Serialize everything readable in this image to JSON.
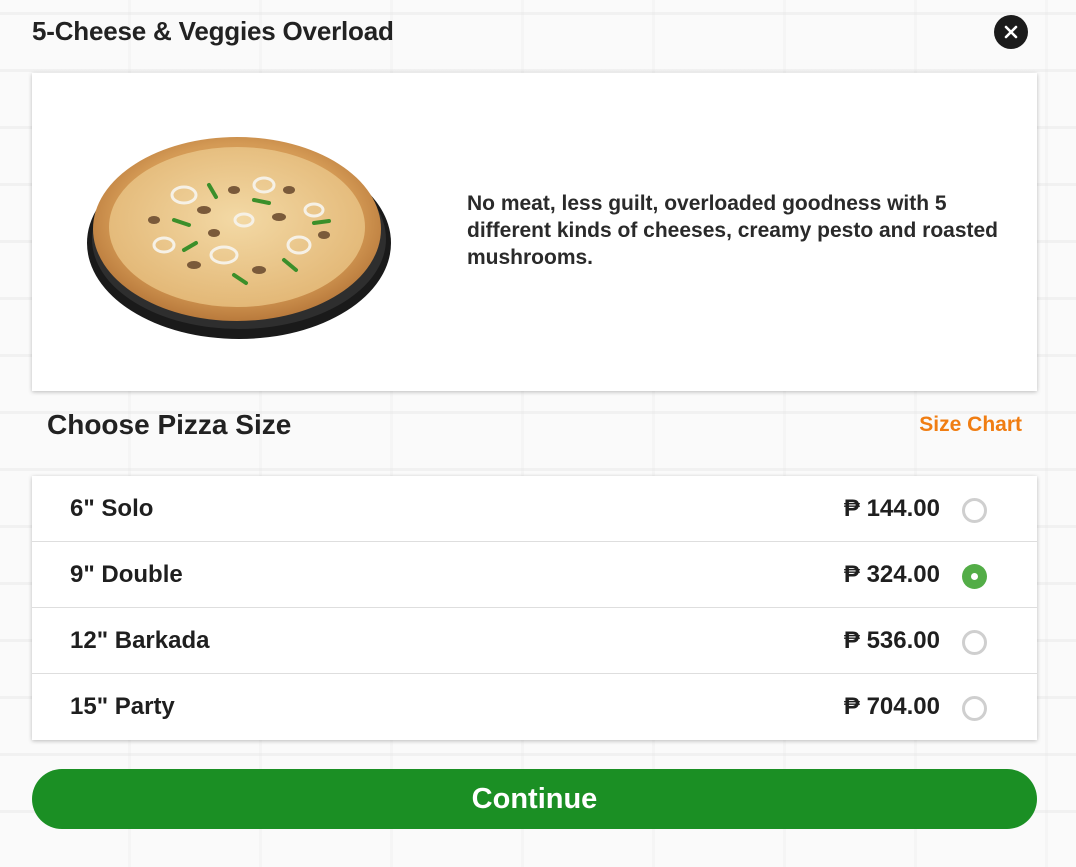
{
  "modal": {
    "title": "5-Cheese & Veggies Overload",
    "close_icon": "close-icon",
    "description": "No meat, less guilt, overloaded goodness with 5 different kinds of cheeses, creamy pesto and roasted mushrooms."
  },
  "sizes": {
    "title": "Choose Pizza Size",
    "size_chart_label": "Size Chart",
    "options": [
      {
        "label": "6\" Solo",
        "price": "₱ 144.00",
        "selected": false
      },
      {
        "label": "9\" Double",
        "price": "₱ 324.00",
        "selected": true
      },
      {
        "label": "12\" Barkada",
        "price": "₱ 536.00",
        "selected": false
      },
      {
        "label": "15\" Party",
        "price": "₱ 704.00",
        "selected": false
      }
    ]
  },
  "actions": {
    "continue_label": "Continue"
  },
  "colors": {
    "accent_green": "#1b8f24",
    "radio_selected": "#53ad47",
    "link_orange": "#f07d12"
  }
}
